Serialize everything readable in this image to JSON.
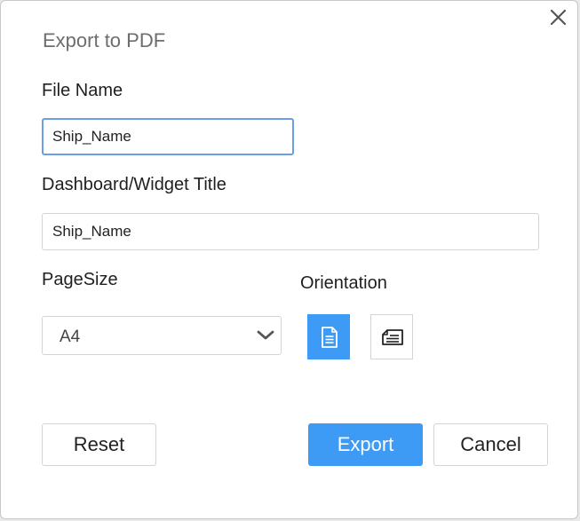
{
  "dialog": {
    "title": "Export to PDF",
    "close_icon": "close-icon"
  },
  "file_name": {
    "label": "File Name",
    "value": "Ship_Name"
  },
  "widget_title": {
    "label": "Dashboard/Widget Title",
    "value": "Ship_Name"
  },
  "page_size": {
    "label": "PageSize",
    "selected": "A4",
    "icon": "chevron-down-icon"
  },
  "orientation": {
    "label": "Orientation",
    "options": [
      {
        "name": "portrait",
        "icon": "portrait-page-icon",
        "selected": true
      },
      {
        "name": "landscape",
        "icon": "landscape-page-icon",
        "selected": false
      }
    ]
  },
  "actions": {
    "reset_label": "Reset",
    "export_label": "Export",
    "cancel_label": "Cancel"
  },
  "colors": {
    "accent": "#3d9bf5",
    "focus_border": "#6a9ee6",
    "title_text": "#6d6d6d"
  }
}
